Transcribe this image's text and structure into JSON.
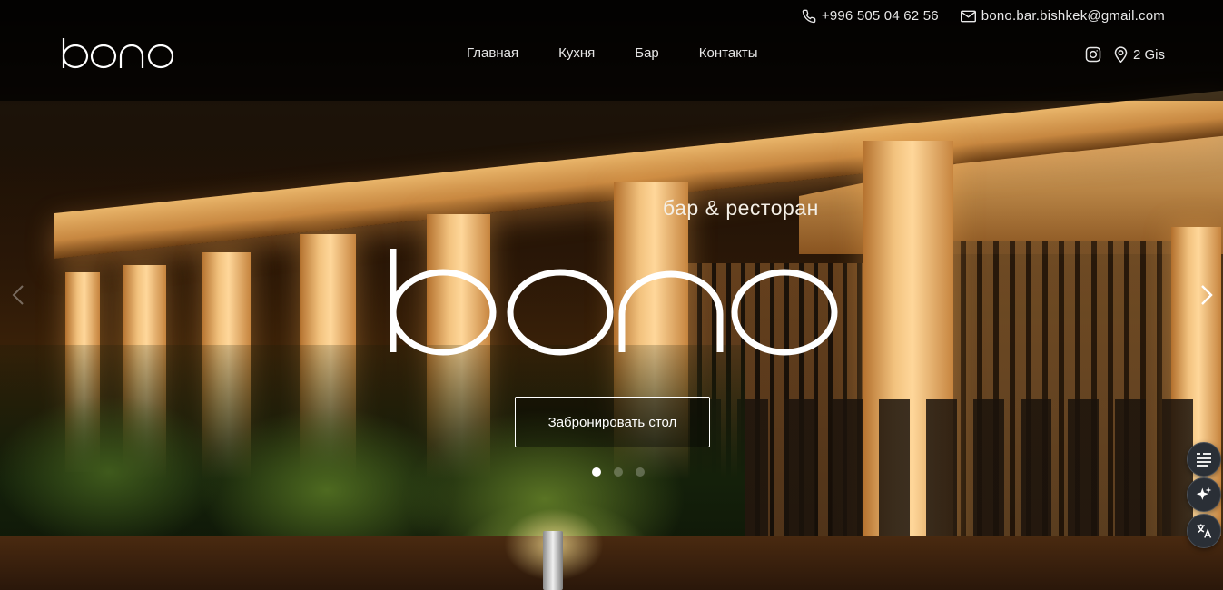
{
  "header": {
    "logo_text": "bono",
    "phone": "+996 505 04 62 56",
    "email": "bono.bar.bishkek@gmail.com",
    "nav": [
      {
        "label": "Главная"
      },
      {
        "label": "Кухня"
      },
      {
        "label": "Бар"
      },
      {
        "label": "Контакты"
      }
    ],
    "instagram_icon": "instagram-icon",
    "map_label": "2 Gis"
  },
  "hero": {
    "subtitle": "бар & ресторан",
    "logo_text": "bono",
    "cta_label": "Забронировать стол",
    "slides": {
      "count": 3,
      "active": 1
    }
  },
  "tools": [
    {
      "icon": "list-icon"
    },
    {
      "icon": "sparkle-icon"
    },
    {
      "icon": "translate-icon"
    }
  ]
}
